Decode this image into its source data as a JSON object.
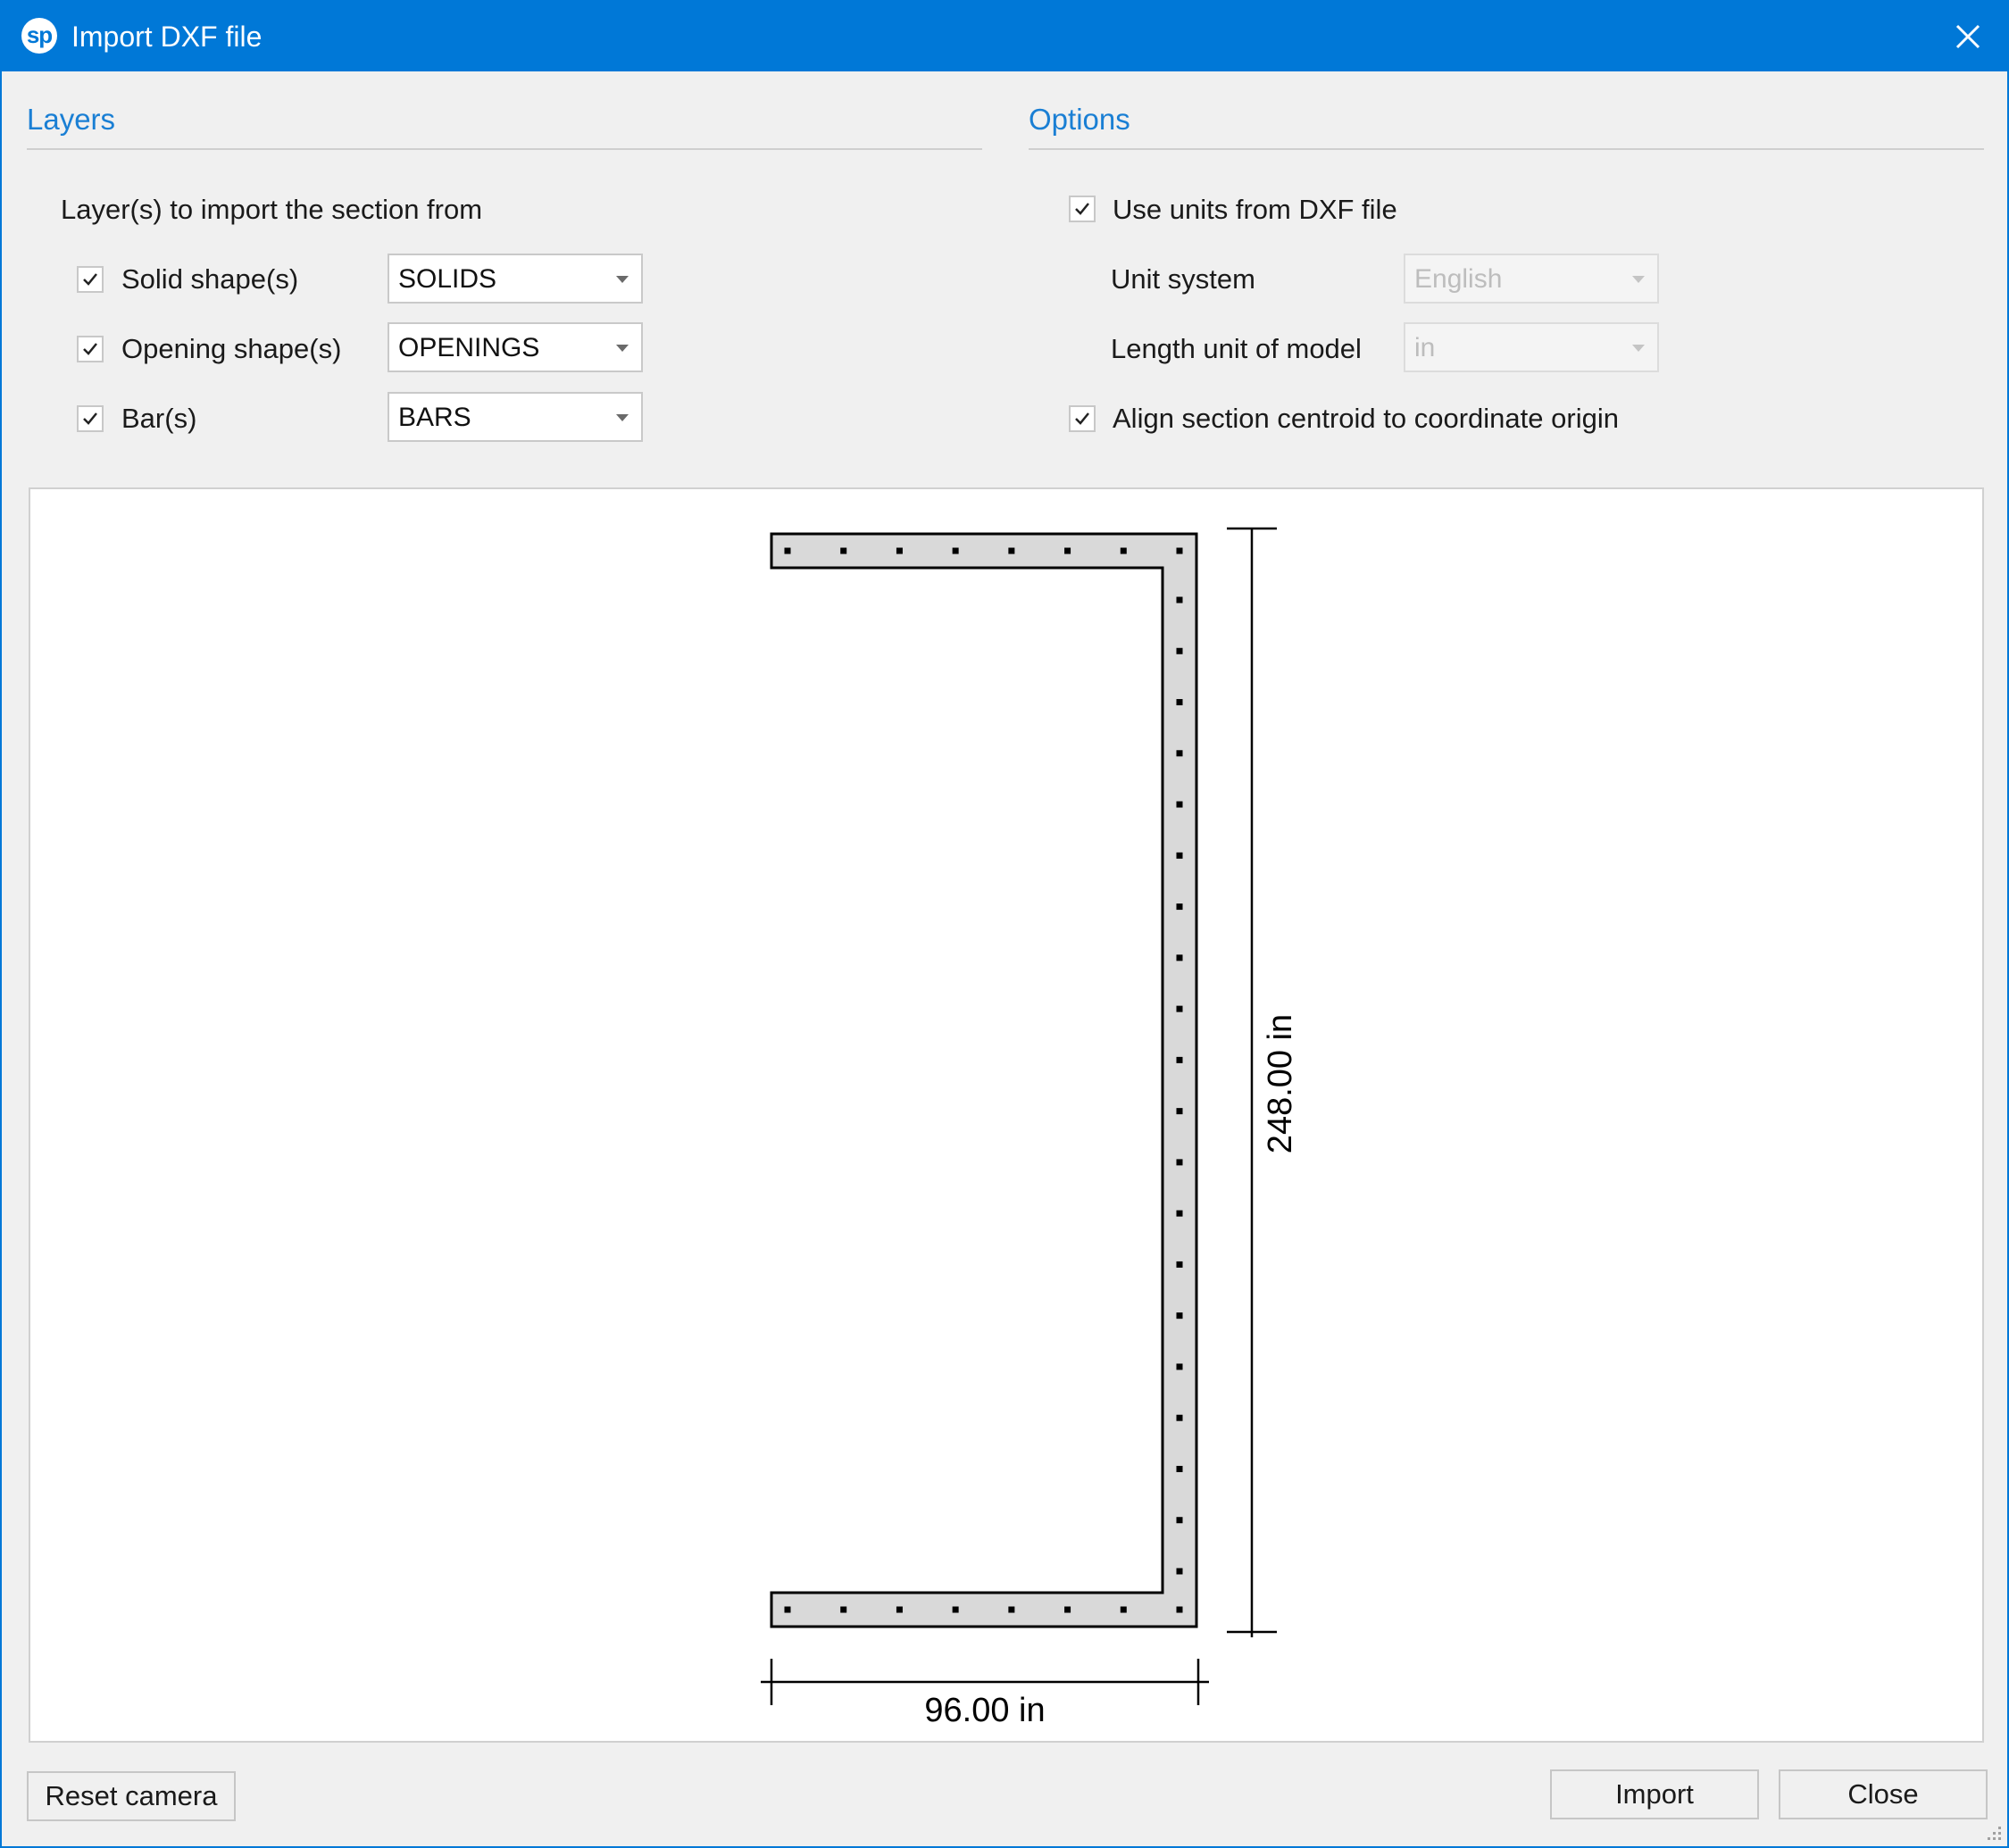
{
  "window": {
    "title": "Import DXF file",
    "logo_text": "sp",
    "accent_color": "#0078d7"
  },
  "layers": {
    "header": "Layers",
    "intro": "Layer(s) to import the section from",
    "rows": [
      {
        "label": "Solid shape(s)",
        "checked": true,
        "selected": "SOLIDS"
      },
      {
        "label": "Opening shape(s)",
        "checked": true,
        "selected": "OPENINGS"
      },
      {
        "label": "Bar(s)",
        "checked": true,
        "selected": "BARS"
      }
    ]
  },
  "options": {
    "header": "Options",
    "use_units_label": "Use units from DXF file",
    "use_units_checked": true,
    "unit_system_label": "Unit system",
    "unit_system_value": "English",
    "length_unit_label": "Length unit of model",
    "length_unit_value": "in",
    "align_label": "Align section centroid to coordinate origin",
    "align_checked": true
  },
  "preview": {
    "height_dimension": "248.00 in",
    "width_dimension": "96.00 in",
    "top_flange_bars": 8,
    "web_bars": 20,
    "bottom_flange_bars": 8,
    "fill_color": "#d9d9d9"
  },
  "buttons": {
    "reset_camera": "Reset camera",
    "import": "Import",
    "close": "Close"
  }
}
